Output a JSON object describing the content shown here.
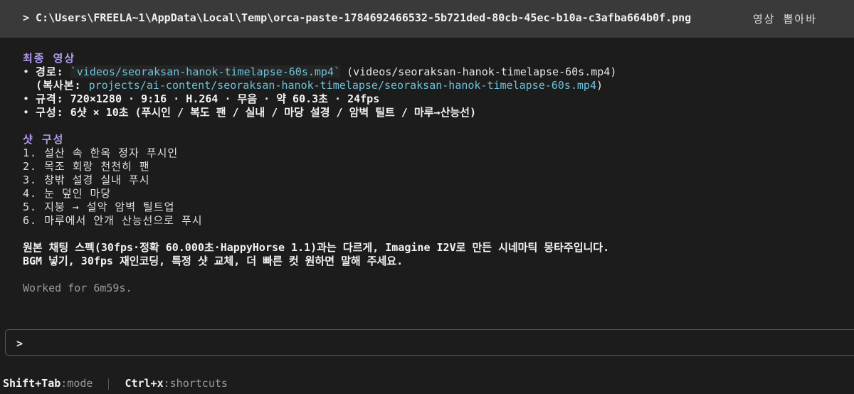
{
  "command_bar": {
    "command": "> C:\\Users\\FREELA~1\\AppData\\Local\\Temp\\orca-paste-1784692466532-5b721ded-80cb-45ec-b10a-c3afba664b0f.png",
    "title": "영상 뽑아바"
  },
  "final_video": {
    "heading": "최종 영상",
    "path_label": "경로:",
    "path_value": "`videos/seoraksan-hanok-timelapse-60s.mp4`",
    "path_plain": "(videos/seoraksan-hanok-timelapse-60s.mp4)",
    "copy_open": "(복사본: ",
    "copy_value": "projects/ai-content/seoraksan-hanok-timelapse/seoraksan-hanok-timelapse-60s.mp4",
    "copy_close": ")",
    "spec_label": "규격:",
    "spec_value": "720×1280 · 9:16 · H.264 · 무음 · 약 60.3초 · 24fps",
    "composition_label": "구성:",
    "composition_value": "6샷 × 10초 (푸시인 / 복도 팬 / 실내 / 마당 설경 / 암벽 틸트 / 마루→산능선)"
  },
  "shots": {
    "heading": "샷 구성",
    "items": [
      "1. 설산 속 한옥 정자 푸시인",
      "2. 목조 회랑 천천히 팬",
      "3. 창밖 설경 실내 푸시",
      "4. 눈 덮인 마당",
      "5. 지붕 → 설악 암벽 틸트업",
      "6. 마루에서 안개 산능선으로 푸시"
    ]
  },
  "notes": {
    "line1": "원본 채팅 스펙(30fps·정확 60.000초·HappyHorse 1.1)과는 다르게, Imagine I2V로 만든 시네마틱 몽타주입니다.",
    "line2": "BGM 넣기, 30fps 재인코딩, 특정 샷 교체, 더 빠른 컷 원하면 말해 주세요."
  },
  "worked_for": "Worked for 6m59s.",
  "input": {
    "prompt": ">"
  },
  "status_bar": {
    "mode_key": "Shift+Tab",
    "mode_desc": ":mode",
    "shortcuts_key": "Ctrl+x",
    "shortcuts_desc": ":shortcuts"
  }
}
